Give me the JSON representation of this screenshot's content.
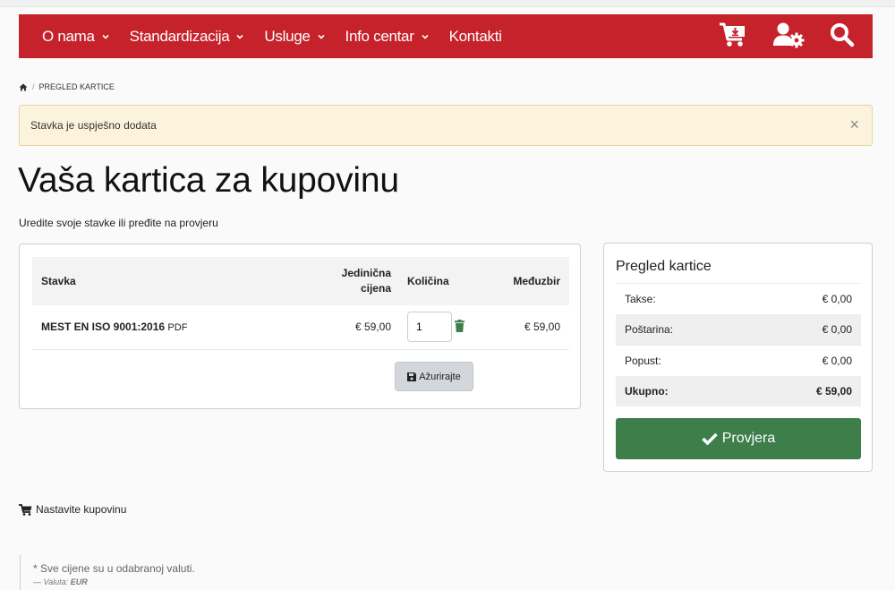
{
  "nav": {
    "items": [
      {
        "label": "O nama",
        "dropdown": true
      },
      {
        "label": "Standardizacija",
        "dropdown": true
      },
      {
        "label": "Usluge",
        "dropdown": true
      },
      {
        "label": "Info centar",
        "dropdown": true
      },
      {
        "label": "Kontakti",
        "dropdown": false
      }
    ],
    "icons": [
      "cart-download-icon",
      "user-settings-icon",
      "search-icon"
    ]
  },
  "breadcrumb": {
    "home_icon": "home-icon",
    "current": "PREGLED KARTICE"
  },
  "alert": {
    "message": "Stavka je uspješno dodata",
    "close": "×"
  },
  "page": {
    "title": "Vaša kartica za kupovinu",
    "subtitle": "Uredite svoje stavke ili pređite na provjeru"
  },
  "cart": {
    "headers": {
      "item": "Stavka",
      "unit_price": "Jedinična cijena",
      "quantity": "Količina",
      "subtotal": "Međuzbir"
    },
    "rows": [
      {
        "name": "MEST EN ISO 9001:2016",
        "format": "PDF",
        "unit_price": "€ 59,00",
        "quantity": "1",
        "subtotal": "€ 59,00"
      }
    ],
    "update_label": "Ažurirajte"
  },
  "summary": {
    "title": "Pregled kartice",
    "rows": [
      {
        "label": "Takse:",
        "value": "€ 0,00"
      },
      {
        "label": "Poštarina:",
        "value": "€ 0,00"
      },
      {
        "label": "Popust:",
        "value": "€ 0,00"
      }
    ],
    "total_label": "Ukupno:",
    "total_value": "€ 59,00",
    "checkout_label": "Provjera"
  },
  "continue_label": "Nastavite kupovinu",
  "footnote": {
    "note": "* Sve cijene su u odabranoj valuti.",
    "currency_prefix": "— Valuta:",
    "currency": "EUR"
  },
  "colors": {
    "brand_red": "#c6222b",
    "checkout_green": "#3d7e4a",
    "alert_bg": "#fcf3dc"
  }
}
